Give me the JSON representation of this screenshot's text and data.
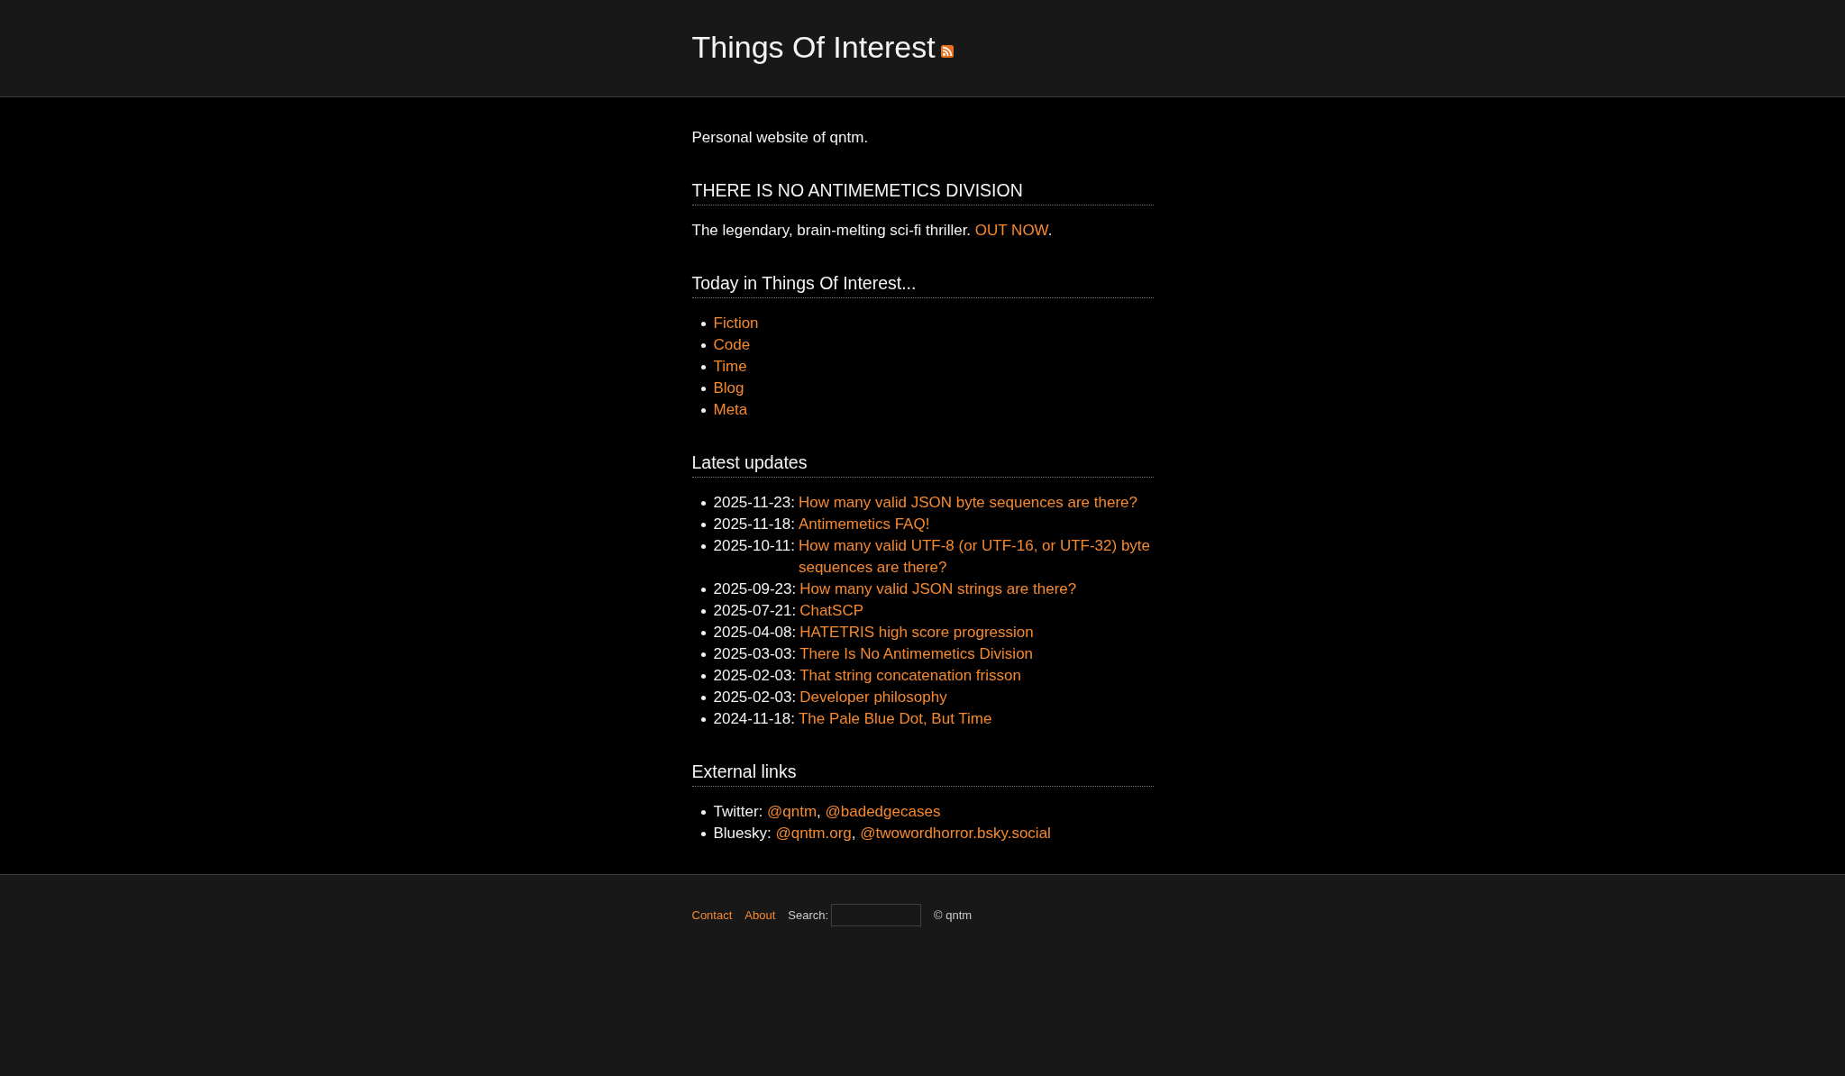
{
  "header": {
    "title": "Things Of Interest"
  },
  "intro": "Personal website of qntm.",
  "sections": [
    {
      "kind": "promo",
      "heading": "THERE IS NO ANTIMEMETICS DIVISION",
      "text": "The legendary, brain-melting sci-fi thriller.",
      "link": "OUT NOW",
      "trailing": "."
    },
    {
      "kind": "links",
      "heading": "Today in Things Of Interest...",
      "items": [
        "Fiction",
        "Code",
        "Time",
        "Blog",
        "Meta"
      ]
    },
    {
      "kind": "updates",
      "heading": "Latest updates",
      "items": [
        {
          "date": "2025-11-23:",
          "title": "How many valid JSON byte sequences are there?"
        },
        {
          "date": "2025-11-18:",
          "title": "Antimemetics FAQ!"
        },
        {
          "date": "2025-10-11:",
          "title": "How many valid UTF-8 (or UTF-16, or UTF-32) byte sequences are there?"
        },
        {
          "date": "2025-09-23:",
          "title": "How many valid JSON strings are there?"
        },
        {
          "date": "2025-07-21:",
          "title": "ChatSCP"
        },
        {
          "date": "2025-04-08:",
          "title": "HATETRIS high score progression"
        },
        {
          "date": "2025-03-03:",
          "title": "There Is No Antimemetics Division"
        },
        {
          "date": "2025-02-03:",
          "title": "That string concatenation frisson"
        },
        {
          "date": "2025-02-03:",
          "title": "Developer philosophy"
        },
        {
          "date": "2024-11-18:",
          "title": "The Pale Blue Dot, But Time"
        }
      ]
    },
    {
      "kind": "social",
      "heading": "External links",
      "items": [
        {
          "label": "Twitter:",
          "separator": ",",
          "links": [
            "@qntm",
            "@badedgecases"
          ]
        },
        {
          "label": "Bluesky:",
          "separator": ",",
          "links": [
            "@qntm.org",
            "@twowordhorror.bsky.social"
          ]
        }
      ]
    }
  ],
  "footer": {
    "links": [
      "Contact",
      "About"
    ],
    "search": {
      "label": "Search:"
    },
    "copyright": "© qntm"
  }
}
